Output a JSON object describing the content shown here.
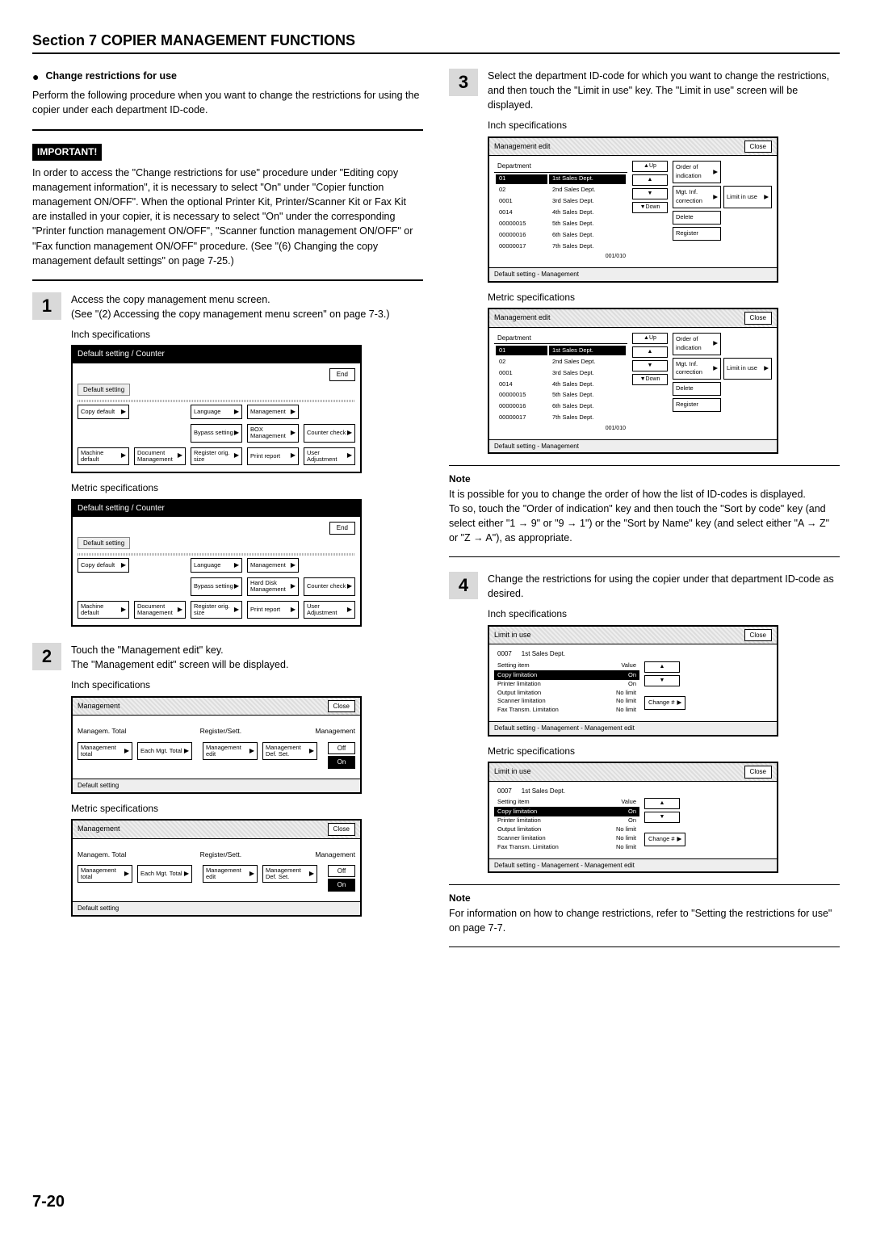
{
  "section_header": "Section 7  COPIER MANAGEMENT FUNCTIONS",
  "sub1_title": "Change restrictions for use",
  "sub1_para": "Perform the following procedure when you want to change the restrictions for using the copier under each department ID-code.",
  "important_label": "IMPORTANT!",
  "important_text": "In order to access the \"Change restrictions for use\" procedure under \"Editing copy management information\", it is necessary to select \"On\" under \"Copier function management ON/OFF\". When the optional Printer Kit, Printer/Scanner Kit or Fax Kit are installed in your copier, it is necessary to select \"On\" under the corresponding \"Printer function management ON/OFF\", \"Scanner function management ON/OFF\" or \"Fax function management ON/OFF\" procedure. (See \"(6) Changing the copy management default settings\" on page 7-25.)",
  "step1_num": "1",
  "step1_text": "Access the copy management menu screen.\n(See \"(2) Accessing the copy management menu screen\" on page 7-3.)",
  "inch_spec": "Inch specifications",
  "metric_spec": "Metric specifications",
  "step2_num": "2",
  "step2_text": "Touch the \"Management edit\" key.\nThe \"Management edit\" screen will be displayed.",
  "step3_num": "3",
  "step3_text": "Select the department ID-code for which you want to change the restrictions, and then touch the \"Limit in use\" key. The \"Limit in use\" screen will be displayed.",
  "note_label": "Note",
  "note1_text": "It is possible for you to change the order of how the list of ID-codes is displayed.\nTo so, touch the \"Order of indication\" key and then touch the \"Sort by code\" key (and select either \"1 → 9\" or \"9 → 1\") or the \"Sort by Name\" key (and select either \"A → Z\" or \"Z → A\"), as appropriate.",
  "step4_num": "4",
  "step4_text": "Change the restrictions for using the copier under that department ID-code as desired.",
  "note2_text": "For information on how to change restrictions, refer to \"Setting the restrictions for use\" on page 7-7.",
  "page_number": "7-20",
  "scr_default_title": "Default setting / Counter",
  "scr_tab_default": "Default setting",
  "scr_end": "End",
  "scr_close": "Close",
  "btns": {
    "copy_default": "Copy default",
    "machine_default": "Machine default",
    "document_mgmt": "Document Management",
    "language": "Language",
    "bypass_setting": "Bypass setting",
    "register_orig": "Register orig. size",
    "management": "Management",
    "box_mgmt": "BOX Management",
    "hard_disk_mgmt": "Hard Disk Management",
    "print_report": "Print report",
    "counter_check": "Counter check",
    "user_adjust": "User Adjustment"
  },
  "mgmt_scr": {
    "title": "Management",
    "col1": "Managem. Total",
    "col2": "Register/Sett.",
    "col3": "Management",
    "b_total": "Management total",
    "b_each": "Each Mgt. Total",
    "b_edit": "Management edit",
    "b_def": "Management Def. Set.",
    "off": "Off",
    "on": "On",
    "footer": "Default setting"
  },
  "edit_scr": {
    "title": "Management edit",
    "dept_hdr": "Department",
    "up": "Up",
    "down": "Down",
    "order": "Order of indication",
    "mgt_inf": "Mgt. Inf. correction",
    "limit": "Limit in use",
    "delete": "Delete",
    "register": "Register",
    "counter": "001/010",
    "footer": "Default setting - Management",
    "rows": [
      {
        "code": "01",
        "dept": "1st Sales Dept."
      },
      {
        "code": "02",
        "dept": "2nd Sales Dept."
      },
      {
        "code": "0001",
        "dept": "3rd Sales Dept."
      },
      {
        "code": "0014",
        "dept": "4th Sales Dept."
      },
      {
        "code": "00000015",
        "dept": "5th Sales Dept."
      },
      {
        "code": "00000016",
        "dept": "6th Sales Dept."
      },
      {
        "code": "00000017",
        "dept": "7th Sales Dept."
      }
    ]
  },
  "limit_scr": {
    "title": "Limit in use",
    "code": "0007",
    "dept": "1st Sales Dept.",
    "h_item": "Setting item",
    "h_value": "Value",
    "change": "Change #",
    "footer": "Default setting - Management - Management edit",
    "rows": [
      {
        "item": "Copy limitation",
        "val": "On",
        "hl": true
      },
      {
        "item": "Printer limitation",
        "val": "On"
      },
      {
        "item": "Output limitation",
        "val": "No limit"
      },
      {
        "item": "Scanner limitation",
        "val": "No limit"
      },
      {
        "item": "Fax Transm. Limitation",
        "val": "No limit"
      }
    ]
  }
}
